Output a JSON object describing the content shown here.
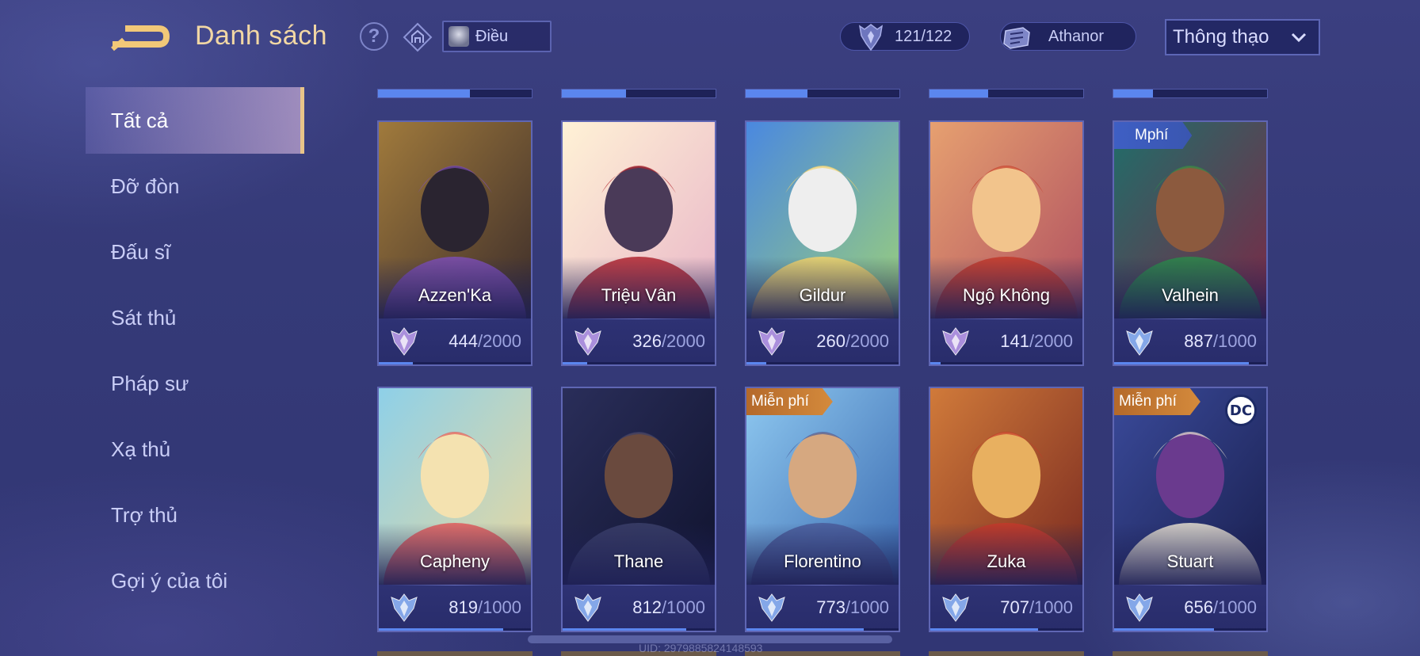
{
  "header": {
    "title": "Danh sách",
    "back_icon": "back-arrow-icon",
    "help_label": "?",
    "lane_filter": {
      "label": "Điều"
    },
    "mastery_count": "121/122",
    "athanor_label": "Athanor",
    "sort": {
      "selected": "Thông thạo"
    }
  },
  "sidebar": {
    "items": [
      {
        "label": "Tất cả",
        "active": true
      },
      {
        "label": "Đỡ đòn"
      },
      {
        "label": "Đấu sĩ"
      },
      {
        "label": "Sát thủ"
      },
      {
        "label": "Pháp sư"
      },
      {
        "label": "Xạ thủ"
      },
      {
        "label": "Trợ thủ"
      },
      {
        "label": "Gợi ý của tôi"
      }
    ]
  },
  "previous_row_progress": [
    0.6,
    0.42,
    0.4,
    0.38,
    0.26
  ],
  "heroes": [
    {
      "name": "Azzen'Ka",
      "points": "444",
      "max": "/2000",
      "progress": 0.222,
      "rank": "purple",
      "badge": "",
      "dc": false
    },
    {
      "name": "Triệu Vân",
      "points": "326",
      "max": "/2000",
      "progress": 0.163,
      "rank": "purple",
      "badge": "",
      "dc": false
    },
    {
      "name": "Gildur",
      "points": "260",
      "max": "/2000",
      "progress": 0.13,
      "rank": "purple",
      "badge": "",
      "dc": false
    },
    {
      "name": "Ngộ Không",
      "points": "141",
      "max": "/2000",
      "progress": 0.07,
      "rank": "purple",
      "badge": "",
      "dc": false
    },
    {
      "name": "Valhein",
      "points": "887",
      "max": "/1000",
      "progress": 0.887,
      "rank": "blue",
      "badge": "Mphí",
      "badge_style": "blue",
      "dc": false
    },
    {
      "name": "Capheny",
      "points": "819",
      "max": "/1000",
      "progress": 0.819,
      "rank": "blue",
      "badge": "",
      "dc": false
    },
    {
      "name": "Thane",
      "points": "812",
      "max": "/1000",
      "progress": 0.812,
      "rank": "blue",
      "badge": "",
      "dc": false
    },
    {
      "name": "Florentino",
      "points": "773",
      "max": "/1000",
      "progress": 0.773,
      "rank": "blue",
      "badge": "Miễn phí",
      "badge_style": "orange",
      "dc": false
    },
    {
      "name": "Zuka",
      "points": "707",
      "max": "/1000",
      "progress": 0.707,
      "rank": "blue",
      "badge": "",
      "dc": false
    },
    {
      "name": "Stuart",
      "points": "656",
      "max": "/1000",
      "progress": 0.656,
      "rank": "blue",
      "badge": "Miễn phí",
      "badge_style": "orange",
      "dc": true,
      "dc_label": "DC"
    }
  ],
  "footer": {
    "uid": "UID: 2979885824148593"
  },
  "colors": {
    "accent_gold": "#f2d7a4",
    "progress_blue": "#5b86ee",
    "rank_purple": "#b89ae8",
    "rank_blue": "#8eb4f6"
  },
  "portraits": [
    {
      "bg": [
        "#a07a3c",
        "#3b2c2a"
      ],
      "fg": "#2a2430",
      "accent": "#7d4fb5"
    },
    {
      "bg": [
        "#fff2d6",
        "#e9b6c8"
      ],
      "fg": "#4a3a58",
      "accent": "#b3262f"
    },
    {
      "bg": [
        "#4a88e0",
        "#9bd07a"
      ],
      "fg": "#eeeeee",
      "accent": "#f2d36b"
    },
    {
      "bg": [
        "#e6a070",
        "#b05060"
      ],
      "fg": "#f2c48c",
      "accent": "#c43a2a"
    },
    {
      "bg": [
        "#1f6e6a",
        "#7c2846"
      ],
      "fg": "#8c5a3e",
      "accent": "#2d8a4a"
    },
    {
      "bg": [
        "#8ed0e8",
        "#e8d8a0"
      ],
      "fg": "#f4e2b0",
      "accent": "#e05a5a"
    },
    {
      "bg": [
        "#2a2e5a",
        "#10132e"
      ],
      "fg": "#6a4a3e",
      "accent": "#3b3f6a"
    },
    {
      "bg": [
        "#8ec8f0",
        "#3a6ab0"
      ],
      "fg": "#d6a880",
      "accent": "#4a5c9a"
    },
    {
      "bg": [
        "#d07a3a",
        "#7a2a20"
      ],
      "fg": "#e8b060",
      "accent": "#c43a2a"
    },
    {
      "bg": [
        "#3a4a9a",
        "#1a2050"
      ],
      "fg": "#6a3a8e",
      "accent": "#e8e0d0"
    }
  ]
}
